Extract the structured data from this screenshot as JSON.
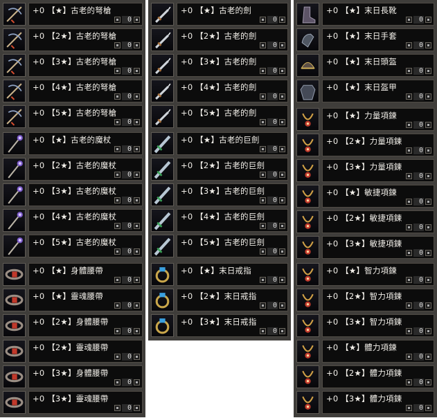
{
  "inventory": {
    "enhance": "+0",
    "columns": [
      {
        "items": [
          {
            "label": "【★】古老的弩槍",
            "qty": "0",
            "icon": "crossbow-icon"
          },
          {
            "label": "【2★】古老的弩槍",
            "qty": "0",
            "icon": "crossbow-icon"
          },
          {
            "label": "【3★】古老的弩槍",
            "qty": "0",
            "icon": "crossbow-icon"
          },
          {
            "label": "【4★】古老的弩槍",
            "qty": "0",
            "icon": "crossbow-icon"
          },
          {
            "label": "【5★】古老的弩槍",
            "qty": "0",
            "icon": "crossbow-icon"
          },
          {
            "label": "【★】古老的魔杖",
            "qty": "0",
            "icon": "wand-icon"
          },
          {
            "label": "【2★】古老的魔杖",
            "qty": "0",
            "icon": "wand-icon"
          },
          {
            "label": "【3★】古老的魔杖",
            "qty": "0",
            "icon": "wand-icon"
          },
          {
            "label": "【4★】古老的魔杖",
            "qty": "0",
            "icon": "wand-icon"
          },
          {
            "label": "【5★】古老的魔杖",
            "qty": "0",
            "icon": "wand-icon"
          },
          {
            "label": "【★】身體腰帶",
            "qty": "0",
            "icon": "belt-icon"
          },
          {
            "label": "【★】靈魂腰帶",
            "qty": "0",
            "icon": "belt-icon"
          },
          {
            "label": "【2★】身體腰帶",
            "qty": "0",
            "icon": "belt-icon"
          },
          {
            "label": "【2★】靈魂腰帶",
            "qty": "0",
            "icon": "belt-icon"
          },
          {
            "label": "【3★】身體腰帶",
            "qty": "0",
            "icon": "belt-icon"
          },
          {
            "label": "【3★】靈魂腰帶",
            "qty": "0",
            "icon": "belt-icon"
          }
        ]
      },
      {
        "items": [
          {
            "label": "【★】古老的劍",
            "qty": "0",
            "icon": "sword-icon"
          },
          {
            "label": "【2★】古老的劍",
            "qty": "0",
            "icon": "sword-icon"
          },
          {
            "label": "【3★】古老的劍",
            "qty": "0",
            "icon": "sword-icon"
          },
          {
            "label": "【4★】古老的劍",
            "qty": "0",
            "icon": "sword-icon"
          },
          {
            "label": "【5★】古老的劍",
            "qty": "0",
            "icon": "sword-icon"
          },
          {
            "label": "【★】古老的巨劍",
            "qty": "0",
            "icon": "greatsword-icon"
          },
          {
            "label": "【2★】古老的巨劍",
            "qty": "0",
            "icon": "greatsword-icon"
          },
          {
            "label": "【3★】古老的巨劍",
            "qty": "0",
            "icon": "greatsword-icon"
          },
          {
            "label": "【4★】古老的巨劍",
            "qty": "0",
            "icon": "greatsword-icon"
          },
          {
            "label": "【5★】古老的巨劍",
            "qty": "0",
            "icon": "greatsword-icon"
          },
          {
            "label": "【★】末日戒指",
            "qty": "0",
            "icon": "ring-icon"
          },
          {
            "label": "【2★】末日戒指",
            "qty": "0",
            "icon": "ring-icon"
          },
          {
            "label": "【3★】末日戒指",
            "qty": "0",
            "icon": "ring-icon"
          }
        ]
      },
      {
        "items": [
          {
            "label": "【★】末日長靴",
            "qty": "0",
            "icon": "boots-icon"
          },
          {
            "label": "【★】末日手套",
            "qty": "0",
            "icon": "gloves-icon"
          },
          {
            "label": "【★】末日頭盔",
            "qty": "0",
            "icon": "helmet-icon"
          },
          {
            "label": "【★】末日盔甲",
            "qty": "0",
            "icon": "armor-icon"
          },
          {
            "label": "【★】力量項鍊",
            "qty": "0",
            "icon": "necklace-icon"
          },
          {
            "label": "【2★】力量項鍊",
            "qty": "0",
            "icon": "necklace-icon"
          },
          {
            "label": "【3★】力量項鍊",
            "qty": "0",
            "icon": "necklace-icon"
          },
          {
            "label": "【★】敏捷項鍊",
            "qty": "0",
            "icon": "necklace-icon"
          },
          {
            "label": "【2★】敏捷項鍊",
            "qty": "0",
            "icon": "necklace-icon"
          },
          {
            "label": "【3★】敏捷項鍊",
            "qty": "0",
            "icon": "necklace-icon"
          },
          {
            "label": "【★】智力項鍊",
            "qty": "0",
            "icon": "necklace-icon"
          },
          {
            "label": "【2★】智力項鍊",
            "qty": "0",
            "icon": "necklace-icon"
          },
          {
            "label": "【3★】智力項鍊",
            "qty": "0",
            "icon": "necklace-icon"
          },
          {
            "label": "【★】體力項鍊",
            "qty": "0",
            "icon": "necklace-icon"
          },
          {
            "label": "【2★】體力項鍊",
            "qty": "0",
            "icon": "necklace-icon"
          },
          {
            "label": "【3★】體力項鍊",
            "qty": "0",
            "icon": "necklace-icon"
          }
        ]
      }
    ]
  }
}
